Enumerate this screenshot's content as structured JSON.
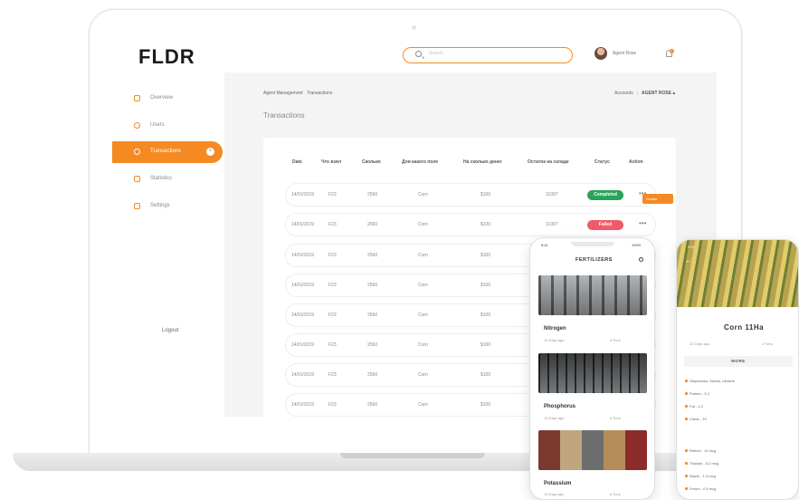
{
  "app": {
    "logo": "FLDR",
    "search_placeholder": "Search",
    "user_name": "Agent Rose",
    "notification_count": "1"
  },
  "sidebar": {
    "items": [
      {
        "label": "Overview",
        "active": false
      },
      {
        "label": "Users",
        "active": false
      },
      {
        "label": "Transactions",
        "active": true,
        "badge": "+"
      },
      {
        "label": "Statistics",
        "active": false
      },
      {
        "label": "Settings",
        "active": false
      }
    ],
    "logout": "Logout"
  },
  "header": {
    "breadcrumb": [
      "Agent Management",
      "Transactions"
    ],
    "accounts": "Accounts",
    "agent": "AGENT ROSE ▴",
    "page_title": "Transactions"
  },
  "table": {
    "columns": [
      "Date",
      "Что взял",
      "Сколько",
      "Для какого поле",
      "На сколько денег",
      "Остаток на складе",
      "Статус",
      "Action"
    ],
    "rows": [
      {
        "date": "14/01/2019",
        "item": "F23",
        "qty": "2560",
        "field": "Corn",
        "money": "$100",
        "stock": "11007",
        "status": "Completed"
      },
      {
        "date": "14/01/2019",
        "item": "F23",
        "qty": "2560",
        "field": "Corn",
        "money": "$100",
        "stock": "11007",
        "status": "Failed"
      },
      {
        "date": "14/01/2019",
        "item": "F23",
        "qty": "2560",
        "field": "Corn",
        "money": "$100"
      },
      {
        "date": "14/01/2019",
        "item": "F23",
        "qty": "2560",
        "field": "Corn",
        "money": "$100"
      },
      {
        "date": "14/01/2019",
        "item": "F23",
        "qty": "2560",
        "field": "Corn",
        "money": "$100"
      },
      {
        "date": "14/01/2019",
        "item": "F23",
        "qty": "2560",
        "field": "Corn",
        "money": "$100"
      },
      {
        "date": "14/01/2019",
        "item": "F23",
        "qty": "2560",
        "field": "Corn",
        "money": "$100"
      },
      {
        "date": "14/01/2019",
        "item": "F23",
        "qty": "2560",
        "field": "Corn",
        "money": "$100"
      }
    ],
    "row_menu_label": "Details"
  },
  "phone_fertilizers": {
    "time": "9:41",
    "battery": "100%",
    "title": "FERTILIZERS",
    "products": [
      {
        "name": "Nitrogen",
        "age": "10 Days ago",
        "weight": "4 Tons"
      },
      {
        "name": "Phosphorus",
        "age": "10 Days ago",
        "weight": "6 Tons"
      },
      {
        "name": "Potassium",
        "age": "10 Days ago",
        "weight": "6 Tons"
      }
    ]
  },
  "phone_corn": {
    "time": "9:41",
    "title": "Corn 11Ha",
    "date": "22 Days ago",
    "weight": "4 Tons",
    "more_label": "MORE",
    "attributes": [
      "Stepanivka, Odesa, Ukraine",
      "Protein - 3.2",
      "Fat - 1.2",
      "Carbs - 19"
    ],
    "vitamins": [
      "Retinol - 10 mcg",
      "Thiamin - 0.2 mcg",
      "Niacin - 1.3 mcg",
      "Ferum - 0.5 mcg"
    ]
  },
  "colors": {
    "accent": "#f58a23",
    "completed": "#27a35a",
    "failed": "#ef5b68"
  }
}
